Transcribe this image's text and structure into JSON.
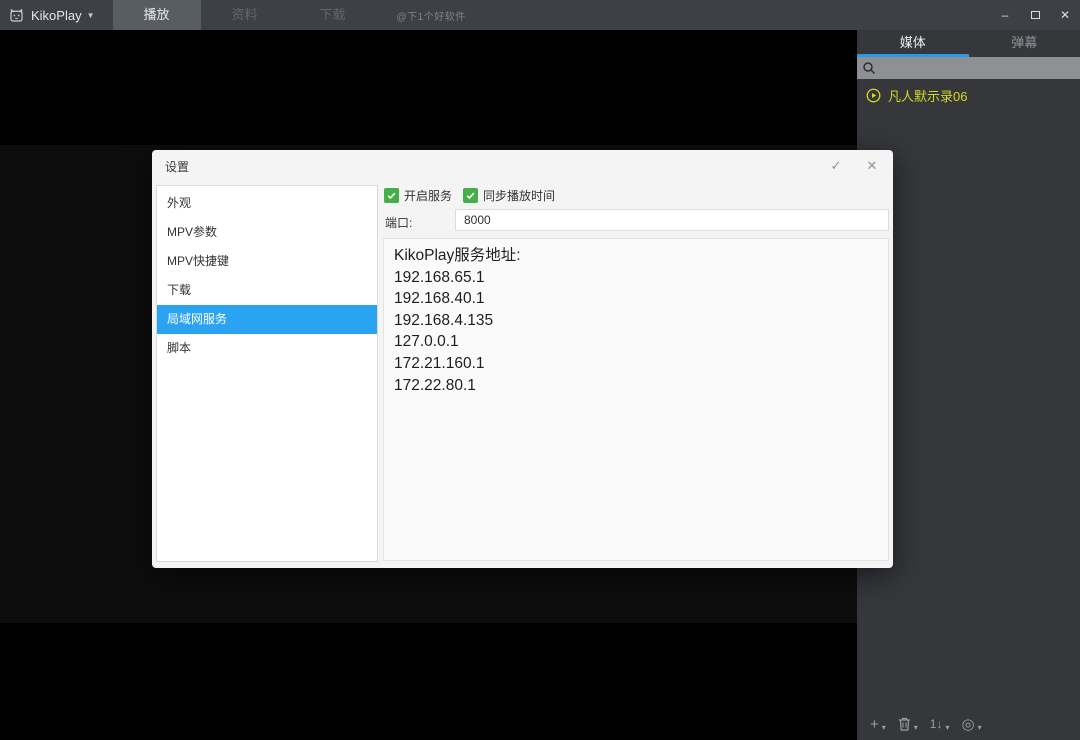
{
  "app": {
    "title": "KikoPlay",
    "watermark": "@下1个好软件"
  },
  "topbar": {
    "tabs": [
      {
        "label": "播放",
        "active": true
      },
      {
        "label": "资料",
        "active": false
      },
      {
        "label": "下载",
        "active": false
      }
    ]
  },
  "window_controls": {
    "minimize": "–",
    "close": "✕"
  },
  "sidebar": {
    "tabs": [
      {
        "label": "媒体",
        "active": true
      },
      {
        "label": "弹幕",
        "active": false
      }
    ],
    "search": {
      "value": ""
    },
    "playlist": [
      {
        "title": "凡人默示录06"
      }
    ],
    "toolbar_icons": [
      {
        "name": "add-icon"
      },
      {
        "name": "delete-icon"
      },
      {
        "name": "sort-icon"
      },
      {
        "name": "loop-icon"
      }
    ]
  },
  "icons": {
    "dropdown_arrow": "▼",
    "caret_down": "▾",
    "add": "+",
    "sort": "1↓",
    "loop": "◎",
    "dialog_ok": "✓",
    "dialog_close": "✕"
  },
  "dialog": {
    "title": "设置",
    "nav": [
      {
        "label": "外观",
        "selected": false
      },
      {
        "label": "MPV参数",
        "selected": false
      },
      {
        "label": "MPV快捷键",
        "selected": false
      },
      {
        "label": "下载",
        "selected": false
      },
      {
        "label": "局域网服务",
        "selected": true
      },
      {
        "label": "脚本",
        "selected": false
      }
    ],
    "options": [
      {
        "label": "开启服务",
        "checked": true
      },
      {
        "label": "同步播放时间",
        "checked": true
      }
    ],
    "port": {
      "label": "端口:",
      "value": "8000"
    },
    "service": {
      "heading": "KikoPlay服务地址:",
      "addresses": [
        "192.168.65.1",
        "192.168.40.1",
        "192.168.4.135",
        "127.0.0.1",
        "172.21.160.1",
        "172.22.80.1"
      ]
    }
  },
  "colors": {
    "accent_blue": "#2aa3f1",
    "tab_underline_blue": "#259ae8",
    "check_green": "#45ae49",
    "playlist_yellow": "#d6d71f",
    "topbar_bg": "#3d4147",
    "sidebar_bg": "#35373b"
  }
}
